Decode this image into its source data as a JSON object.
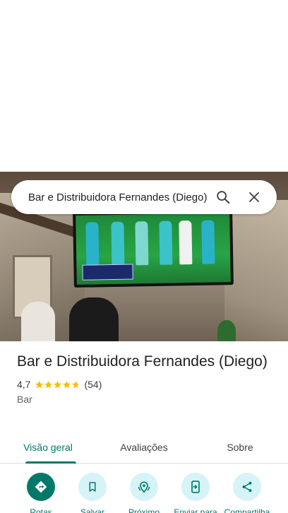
{
  "search": {
    "query": "Bar e Distribuidora Fernandes (Diego)"
  },
  "place": {
    "name": "Bar e Distribuidora Fernandes (Diego)",
    "rating": "4,7",
    "stars": 4.7,
    "reviews_count": "(54)",
    "category": "Bar"
  },
  "tabs": [
    {
      "label": "Visão geral",
      "active": true
    },
    {
      "label": "Avaliações",
      "active": false
    },
    {
      "label": "Sobre",
      "active": false
    }
  ],
  "actions": [
    {
      "label": "Rotas",
      "icon": "directions-icon"
    },
    {
      "label": "Salvar",
      "icon": "bookmark-icon"
    },
    {
      "label": "Próximo",
      "icon": "nearby-icon"
    },
    {
      "label": "Enviar para",
      "icon": "send-to-phone-icon"
    },
    {
      "label": "Compartilha",
      "icon": "share-icon"
    }
  ],
  "colors": {
    "accent": "#00796b",
    "action_bg": "#d6f3f7",
    "star": "#fbbc04"
  }
}
